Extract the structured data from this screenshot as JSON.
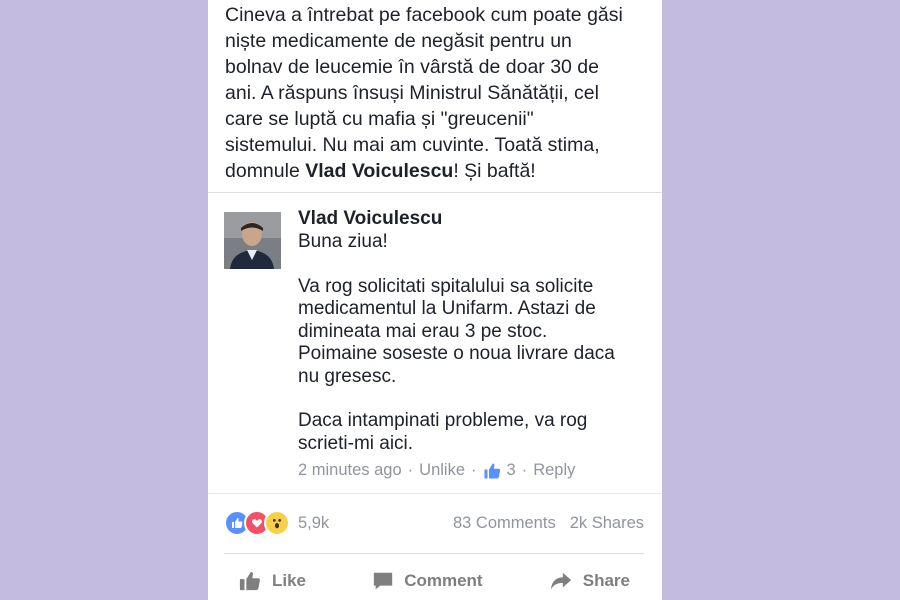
{
  "post": {
    "text_lines": [
      "Cineva a întrebat pe facebook cum poate găsi",
      "niște medicamente de negăsit pentru un",
      "bolnav de leucemie în vârstă de doar 30 de",
      "ani. A răspuns însuși Ministrul Sănătății, cel",
      "care se luptă cu mafia și \"greucenii\"",
      "sistemului. Nu mai am cuvinte. Toată stima,"
    ],
    "last_line_prefix": "domnule ",
    "last_line_bold": "Vlad Voiculescu",
    "last_line_suffix": "! Și baftă!"
  },
  "comment": {
    "author": "Vlad Voiculescu",
    "greeting": "Buna ziua!",
    "paragraph1": [
      "Va rog solicitati spitalului sa solicite",
      "medicamentul la Unifarm. Astazi de",
      "dimineata mai erau 3 pe stoc.",
      "Poimaine soseste o noua livrare daca",
      "nu gresesc."
    ],
    "paragraph2": [
      "Daca intampinati probleme, va rog",
      "scrieti-mi aici."
    ],
    "time": "2 minutes ago",
    "separator": "·",
    "unlike_label": "Unlike",
    "like_count": "3",
    "reply_label": "Reply"
  },
  "stats": {
    "reactions_count": "5,9k",
    "comments": "83 Comments",
    "shares": "2k Shares"
  },
  "actions": {
    "like": "Like",
    "comment": "Comment",
    "share": "Share"
  },
  "colors": {
    "background": "#c3bbe0",
    "like_blue": "#5890ff",
    "love_red": "#f25268",
    "wow_yellow": "#f7d04a",
    "meta_gray": "#90949c"
  }
}
